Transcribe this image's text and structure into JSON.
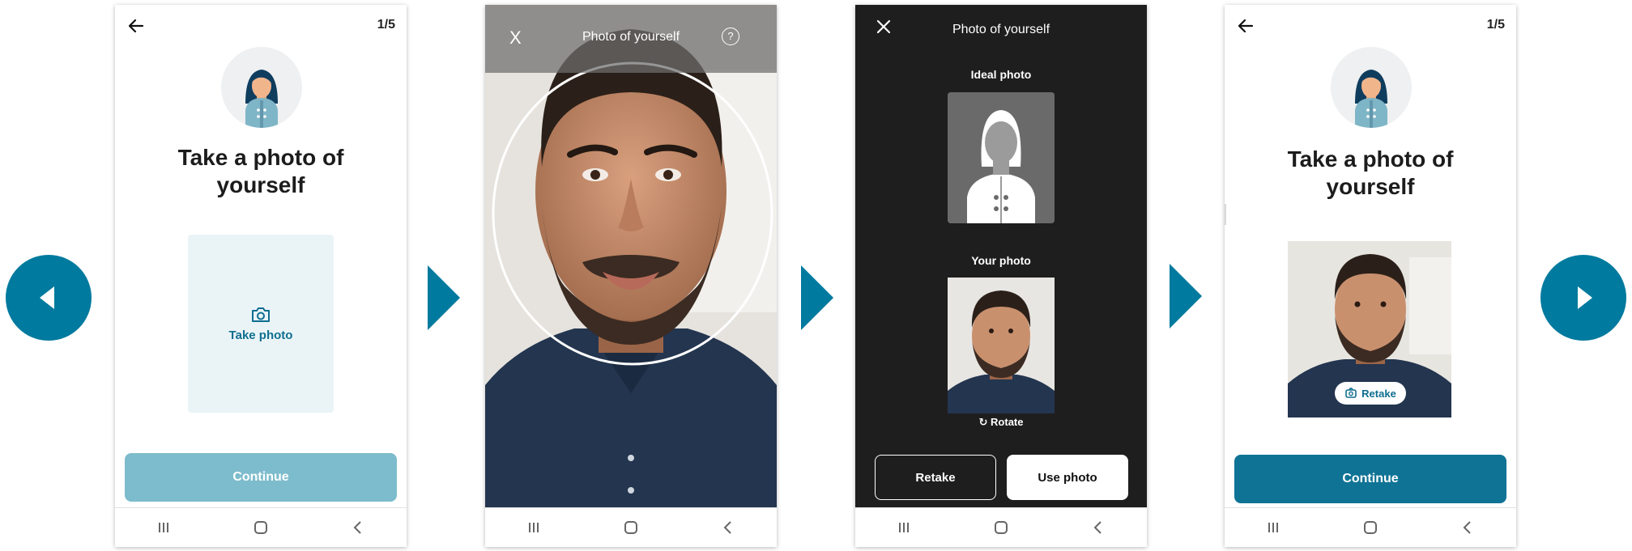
{
  "colors": {
    "accent": "#007a9e",
    "continue_disabled": "#7dbccc",
    "continue_enabled": "#0f7396",
    "take_photo_box": "#eaf4f7",
    "dark_bg": "#1e1e1e"
  },
  "carousel": {
    "prev_icon": "chevron-left-icon",
    "next_icon": "chevron-right-icon",
    "step_arrow_icon": "step-arrow-icon"
  },
  "screen1": {
    "step": "1/5",
    "title_line1": "Take a photo of",
    "title_line2": "yourself",
    "take_photo_label": "Take photo",
    "continue_label": "Continue",
    "continue_state": "disabled"
  },
  "screen2": {
    "close_label": "X",
    "title": "Photo of yourself",
    "help_label": "?"
  },
  "screen3": {
    "title": "Photo of yourself",
    "ideal_label": "Ideal photo",
    "your_label": "Your photo",
    "rotate_label": "Rotate",
    "retake_label": "Retake",
    "use_label": "Use photo"
  },
  "screen4": {
    "step": "1/5",
    "title_line1": "Take a photo of",
    "title_line2": "yourself",
    "retake_label": "Retake",
    "continue_label": "Continue",
    "continue_state": "enabled"
  },
  "system_nav": {
    "recents_icon": "recents-icon",
    "home_icon": "home-icon",
    "back_icon": "back-icon"
  }
}
